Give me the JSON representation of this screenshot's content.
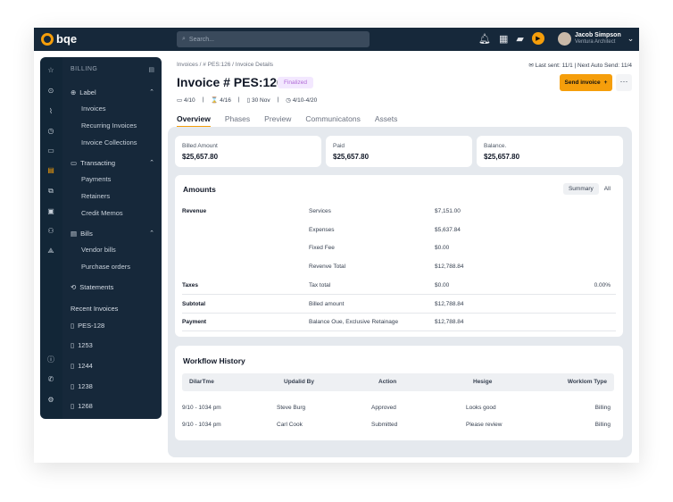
{
  "topbar": {
    "logo": "bqe",
    "search_placeholder": "Search...",
    "user_name": "Jacob Simpson",
    "user_role": "Ventura Architect"
  },
  "nav": {
    "header": "BILLING",
    "groups": [
      {
        "label": "Label",
        "items": [
          "Invoices",
          "Recurring Invoices",
          "Invoice Collections"
        ]
      },
      {
        "label": "Transacting",
        "items": [
          "Payments",
          "Retainers",
          "Credit Memos"
        ]
      },
      {
        "label": "Bills",
        "items": [
          "Vendor bills",
          "Purchase orders"
        ]
      }
    ],
    "statements": "Statements",
    "recent_header": "Recent Invoices",
    "recent": [
      "PES-128",
      "1253",
      "1244",
      "1238",
      "1268"
    ]
  },
  "main": {
    "breadcrumb": "Invoices / # PES:126 / Invoice Details",
    "sent_info": "Last sent: 11/1   |   Next Auto Send: 11/4",
    "title": "Invoice # PES:126",
    "status": "Finalized",
    "send_label": "Send invoice",
    "meta": [
      "4/10",
      "4/16",
      "30 Nov",
      "4/10-4/20"
    ],
    "tabs": [
      "Overview",
      "Phases",
      "Preview",
      "Communicatons",
      "Assets"
    ]
  },
  "summary": [
    {
      "label": "Billed Amount",
      "value": "$25,657.80"
    },
    {
      "label": "Paid",
      "value": "$25,657.80"
    },
    {
      "label": "Balance.",
      "value": "$25,657.80"
    }
  ],
  "amounts": {
    "title": "Amounts",
    "toggle": [
      "Summary",
      "All"
    ],
    "rows": [
      {
        "section": "Revenue",
        "label": "Services",
        "value": "$7,151.00",
        "extra": ""
      },
      {
        "section": "",
        "label": "Expenses",
        "value": "$5,637.84",
        "extra": ""
      },
      {
        "section": "",
        "label": "Fixed Fee",
        "value": "$0.00",
        "extra": ""
      },
      {
        "section": "",
        "label": "Revenve Total",
        "value": "$12,788.84",
        "extra": ""
      },
      {
        "section": "Taxes",
        "label": "Tax total",
        "value": "$0.00",
        "extra": "0.00%"
      },
      {
        "section": "Subtotal",
        "label": "Billed amount",
        "value": "$12,788.84",
        "extra": ""
      },
      {
        "section": "Payment",
        "label": "Balance Oue, Exclusive Retainage",
        "value": "$12,788.84",
        "extra": ""
      }
    ]
  },
  "workflow": {
    "title": "Workflow History",
    "columns": [
      "DilarTme",
      "Updalid By",
      "Action",
      "Hesige",
      "Worklom Type"
    ],
    "rows": [
      [
        "9/10 - 1034 pm",
        "Steve Burg",
        "Approved",
        "Looks good",
        "Billing"
      ],
      [
        "9/10 - 1034 pm",
        "Carl Cook",
        "Submitted",
        "Please review",
        "Billing"
      ]
    ]
  }
}
